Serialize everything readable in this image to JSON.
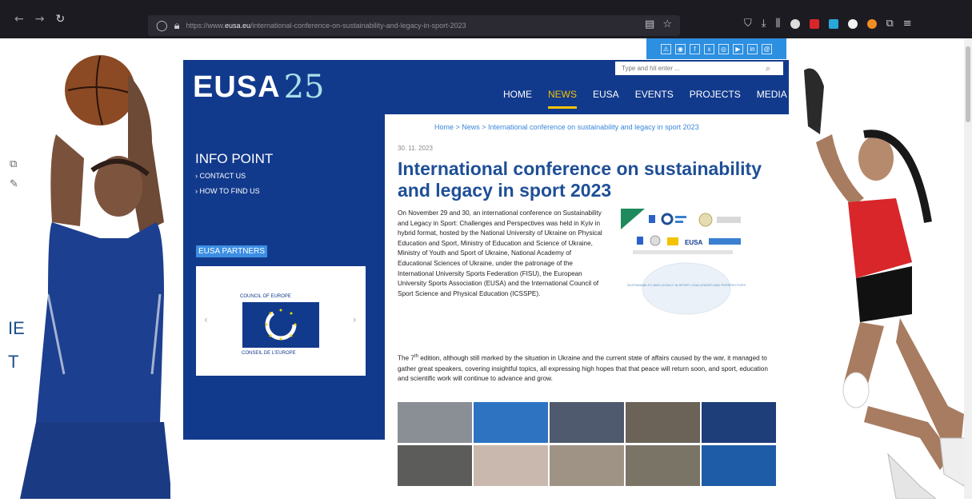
{
  "browser": {
    "url_prefix": "https://www.",
    "url_domain": "eusa.eu",
    "url_path": "/international-conference-on-sustainability-and-legacy-in-sport-2023"
  },
  "social": [
    "⚠",
    "rss",
    "f",
    "x",
    "ig",
    "yt",
    "in",
    "@"
  ],
  "header": {
    "logo_text": "EUSA",
    "logo_anniversary": "25",
    "search_placeholder": "Type and hit enter ...",
    "nav": [
      "HOME",
      "NEWS",
      "EUSA",
      "EVENTS",
      "PROJECTS",
      "MEDIA"
    ],
    "nav_active": "NEWS"
  },
  "sidebar": {
    "info_title": "INFO POINT",
    "links": [
      "CONTACT US",
      "HOW TO FIND US"
    ],
    "partners_title": "EUSA PARTNERS",
    "partner_top": "COUNCIL OF EUROPE",
    "partner_bottom": "CONSEIL DE L'EUROPE"
  },
  "background_text": [
    "IE",
    "T"
  ],
  "breadcrumb": "Home  >  News  >  International conference on sustainability and legacy in sport 2023",
  "article": {
    "date": "30. 11. 2023",
    "title": "International conference on sustainability and legacy in sport 2023",
    "p1": "On November 29 and 30, an international conference on Sustainability and Legacy in Sport: Challenges and Perspectives was held in Kyiv in hybrid format, hosted by the National University of Ukraine on Physical Education and Sport, Ministry of Education and Science of Ukraine, Ministry of Youth and Sport of Ukraine, National Academy of Educational Sciences of Ukraine, under the patronage of the International University Sports Federation (FISU), the European University Sports Association (EUSA) and the International Council of Sport Science and Physical Education (ICSSPE).",
    "p2_before": "The 7",
    "p2_sup": "th",
    "p2_after": " edition, although still marked by the situation in Ukraine and the current state of affairs caused by the war, it managed to gather great speakers, covering insightful topics, all expressing high hopes that that peace will return soon, and sport, education and scientific work will continue to advance and grow.",
    "poster_caption": "SUSTAINABILITY AND LEGACY IN SPORT: CHALLENGES AND PERSPECTIVES",
    "poster_logo": "EUSA"
  },
  "colors": {
    "brand_navy": "#123a8c",
    "accent_blue": "#2d8fe0",
    "nav_active": "#f4c200",
    "title_blue": "#1e4f97"
  }
}
